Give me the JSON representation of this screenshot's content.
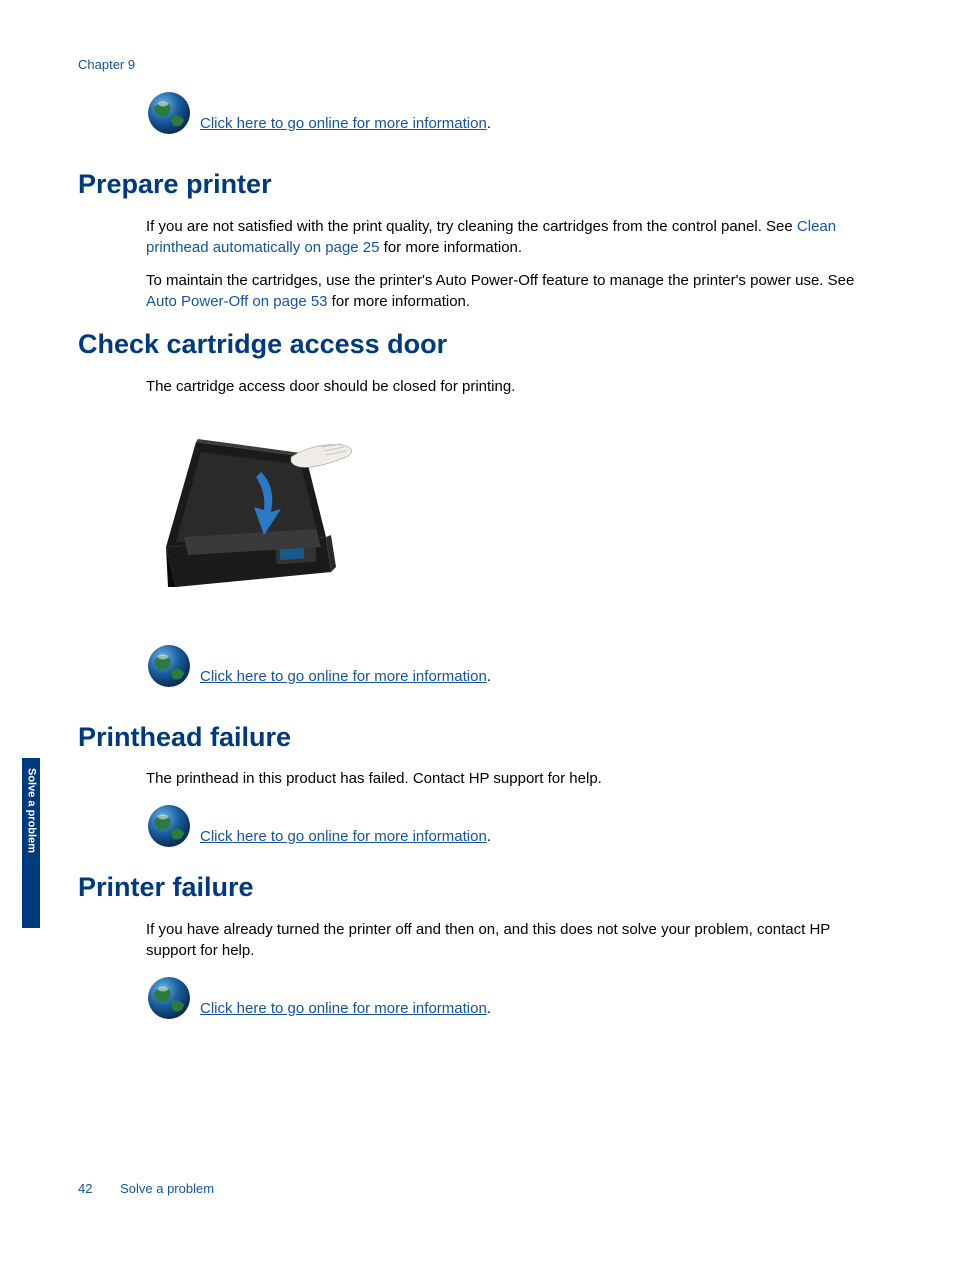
{
  "chapter": "Chapter 9",
  "sideTab": "Solve a problem",
  "onlineLink": "Click here to go online for more information",
  "sections": {
    "prepare": {
      "heading": "Prepare printer",
      "p1a": "If you are not satisfied with the print quality, try cleaning the cartridges from the control panel. See ",
      "p1link": "Clean printhead automatically on page 25",
      "p1b": " for more information.",
      "p2a": "To maintain the cartridges, use the printer's Auto Power-Off feature to manage the printer's power use. See ",
      "p2link": "Auto Power-Off on page 53",
      "p2b": " for more information."
    },
    "door": {
      "heading": "Check cartridge access door",
      "p1": "The cartridge access door should be closed for printing."
    },
    "printhead": {
      "heading": "Printhead failure",
      "p1": "The printhead in this product has failed. Contact HP support for help."
    },
    "printer": {
      "heading": "Printer failure",
      "p1": "If you have already turned the printer off and then on, and this does not solve your problem, contact HP support for help."
    }
  },
  "footer": {
    "pageNum": "42",
    "section": "Solve a problem"
  }
}
